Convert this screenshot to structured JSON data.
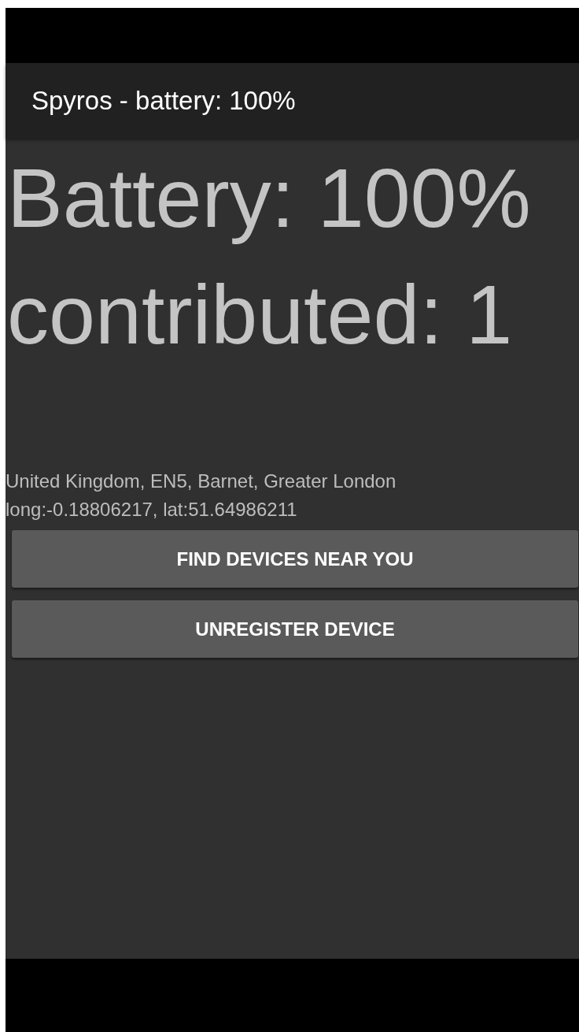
{
  "app_bar": {
    "title": "Spyros - battery: 100%"
  },
  "battery": "Battery: 100%",
  "contributed": "contributed: 1",
  "location": {
    "address": "United Kingdom, EN5, Barnet, Greater London",
    "coordinates": "long:-0.18806217, lat:51.64986211"
  },
  "buttons": [
    {
      "label": "FIND DEVICES NEAR YOU"
    },
    {
      "label": "UNREGISTER DEVICE"
    }
  ]
}
